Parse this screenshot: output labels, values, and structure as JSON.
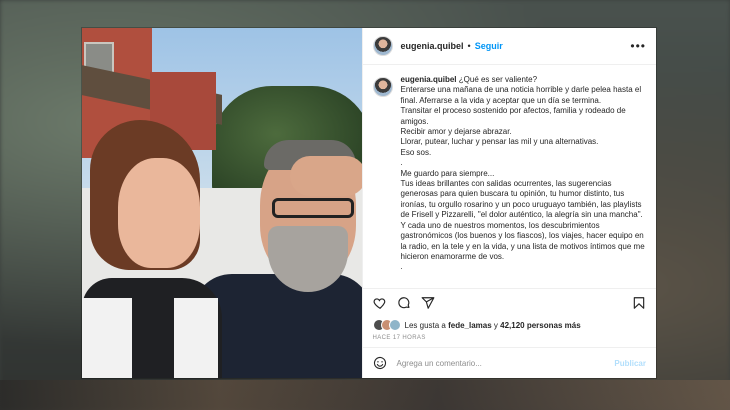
{
  "post": {
    "username": "eugenia.quibel",
    "separator": "•",
    "follow_label": "Seguir",
    "more_label": "•••",
    "caption_username": "eugenia.quibel",
    "caption_text": " ¿Qué es ser valiente?\nEnterarse una mañana de una noticia horrible y darle pelea hasta el final. Aferrarse a la vida y aceptar que un día se termina.\nTransitar el proceso sostenido por afectos, familia y rodeado de amigos.\nRecibir amor y dejarse abrazar.\nLlorar, putear, luchar y pensar las mil y una alternativas.\nEso sos.\n.\nMe guardo para siempre...\nTus ideas brillantes con salidas ocurrentes, las sugerencias generosas para quien buscara tu opinión, tu humor distinto, tus ironías, tu orgullo rosarino y un poco uruguayo también, las playlists de Frisell y Pizzarelli, \"el dolor auténtico, la alegría sin una mancha\".\nY cada uno de nuestros momentos, los descubrimientos gastronómicos (los buenos y los fiascos), los viajes, hacer equipo en la radio, en la tele y en la vida, y una lista de motivos íntimos que me hicieron enamorarme de vos.\n.",
    "likes_prefix": "Les gusta a ",
    "likes_user": "fede_lamas",
    "likes_middle": " y ",
    "likes_count": "42,120 personas más",
    "time_ago": "HACE 17 HORAS",
    "comment_placeholder": "Agrega un comentario...",
    "publish_label": "Publicar"
  },
  "icons": {
    "like": "heart-icon",
    "comment": "comment-icon",
    "share": "share-icon",
    "save": "bookmark-icon",
    "emoji": "emoji-icon"
  },
  "colors": {
    "link_blue": "#0095f6",
    "publish_disabled": "#b2dffc",
    "text": "#262626",
    "muted": "#8e8e8e"
  }
}
